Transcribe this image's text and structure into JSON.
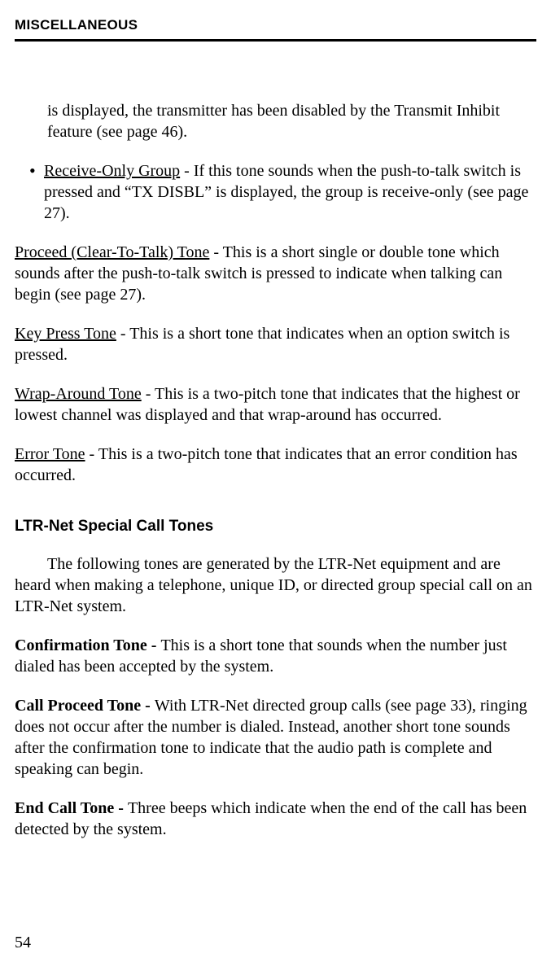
{
  "header": "MISCELLANEOUS",
  "intro_continuation": "is displayed, the transmitter has been disabled by the Transmit Inhibit feature (see page 46).",
  "bullet": {
    "label": "Receive-Only Group",
    "text": " - If this tone sounds when the push-to-talk switch is pressed and “TX DISBL” is displayed, the group is receive-only (see page 27)."
  },
  "tones": {
    "proceed": {
      "label": "Proceed (Clear-To-Talk) Tone",
      "text": " - This is a short single or double tone which sounds after the push-to-talk switch is pressed to indicate when talking can begin (see page 27)."
    },
    "keypress": {
      "label": "Key Press Tone",
      "text": " - This is a short tone that indicates when an option switch is pressed."
    },
    "wrap": {
      "label": "Wrap-Around Tone",
      "text": " - This is a two-pitch tone that indicates that the highest or lowest channel was displayed and that wrap-around has occurred."
    },
    "error": {
      "label": "Error Tone",
      "text": " - This is a two-pitch tone that indicates that an error condition has occurred."
    }
  },
  "subhead": "LTR-Net Special Call Tones",
  "subintro": "The following tones are generated by the LTR-Net equipment and are heard when making a telephone, unique ID, or directed group special call on an LTR-Net system.",
  "special": {
    "confirm": {
      "label": "Confirmation Tone - ",
      "text": "This is a short tone that sounds when the number just dialed has been accepted by the system."
    },
    "callproceed": {
      "label": "Call Proceed Tone - ",
      "text": "With LTR-Net directed group calls (see page 33), ringing does not occur after the number is dialed. Instead, another short tone sounds after the confirmation tone to indicate that the audio path is complete and speaking can begin."
    },
    "endcall": {
      "label": "End Call Tone - ",
      "text": "Three beeps which indicate when the end of the call has been detected by the system."
    }
  },
  "pagenum": "54"
}
